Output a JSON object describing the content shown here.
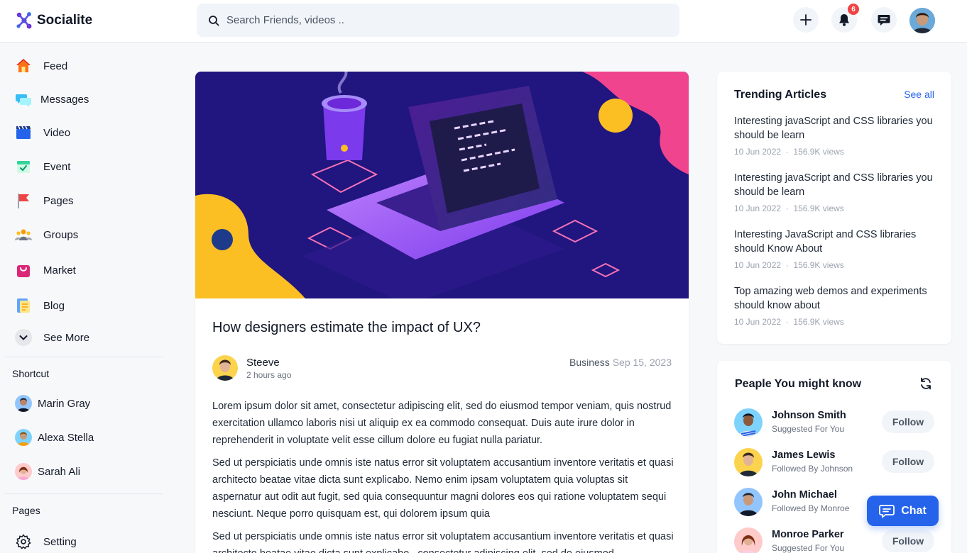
{
  "app": {
    "name": "Socialite"
  },
  "search": {
    "placeholder": "Search Friends, videos .."
  },
  "header": {
    "notification_count": "6"
  },
  "sidebar": {
    "items": [
      {
        "label": "Feed",
        "icon": "home-icon"
      },
      {
        "label": "Messages",
        "icon": "messages-icon"
      },
      {
        "label": "Video",
        "icon": "video-icon"
      },
      {
        "label": "Event",
        "icon": "event-icon"
      },
      {
        "label": "Pages",
        "icon": "flag-icon"
      },
      {
        "label": "Groups",
        "icon": "groups-icon"
      },
      {
        "label": "Market",
        "icon": "market-icon"
      },
      {
        "label": "Blog",
        "icon": "blog-icon"
      },
      {
        "label": "See More",
        "icon": "chevron-down-icon"
      }
    ],
    "shortcut_title": "Shortcut",
    "shortcuts": [
      {
        "label": "Marin Gray"
      },
      {
        "label": "Alexa Stella"
      },
      {
        "label": "Sarah Ali"
      }
    ],
    "pages_title": "Pages",
    "pages": [
      {
        "label": "Setting",
        "icon": "gear-icon"
      }
    ]
  },
  "post": {
    "title": "How designers estimate the impact of UX?",
    "author": "Steeve",
    "time": "2 hours ago",
    "category": "Business",
    "date": "Sep 15, 2023",
    "paragraphs": [
      "Lorem ipsum dolor sit amet, consectetur adipiscing elit, sed do eiusmod tempor veniam, quis nostrud exercitation ullamco laboris nisi ut aliquip ex ea commodo consequat. Duis aute irure dolor in reprehenderit in voluptate velit esse cillum dolore eu fugiat nulla pariatur.",
      "Sed ut perspiciatis unde omnis iste natus error sit voluptatem accusantium inventore veritatis et quasi architecto beatae vitae dicta sunt explicabo. Nemo enim ipsam voluptatem quia voluptas sit aspernatur aut odit aut fugit, sed quia consequuntur magni dolores eos qui ratione voluptatem sequi nesciunt. Neque porro quisquam est, qui dolorem ipsum quia",
      "Sed ut perspiciatis unde omnis iste natus error sit voluptatem accusantium inventore veritatis et quasi architecto beatae vitae dicta sunt explicabo , consectetur adipiscing elit, sed do eiusmod"
    ]
  },
  "trending": {
    "title": "Trending Articles",
    "see_all": "See all",
    "articles": [
      {
        "title": "Interesting javaScript and CSS libraries you should be learn",
        "date": "10 Jun 2022",
        "views": "156.9K views"
      },
      {
        "title": "Interesting javaScript and CSS libraries you should be learn",
        "date": "10 Jun 2022",
        "views": "156.9K views"
      },
      {
        "title": "Interesting JavaScript and CSS libraries should Know About",
        "date": "10 Jun 2022",
        "views": "156.9K views"
      },
      {
        "title": "Top amazing web demos and experiments should know about",
        "date": "10 Jun 2022",
        "views": "156.9K views"
      }
    ],
    "separator": "·"
  },
  "people": {
    "title": "Peaple You might know",
    "follow_label": "Follow",
    "list": [
      {
        "name": "Johnson Smith",
        "sub": "Suggested For You"
      },
      {
        "name": "James Lewis",
        "sub": "Followed By Johnson"
      },
      {
        "name": "John Michael",
        "sub": "Followed By Monroe"
      },
      {
        "name": "Monroe Parker",
        "sub": "Suggested For You"
      }
    ]
  },
  "chat": {
    "label": "Chat"
  },
  "colors": {
    "accent": "#2563eb",
    "badge": "#ef4444",
    "hero_bg": "#1e1b7a"
  }
}
